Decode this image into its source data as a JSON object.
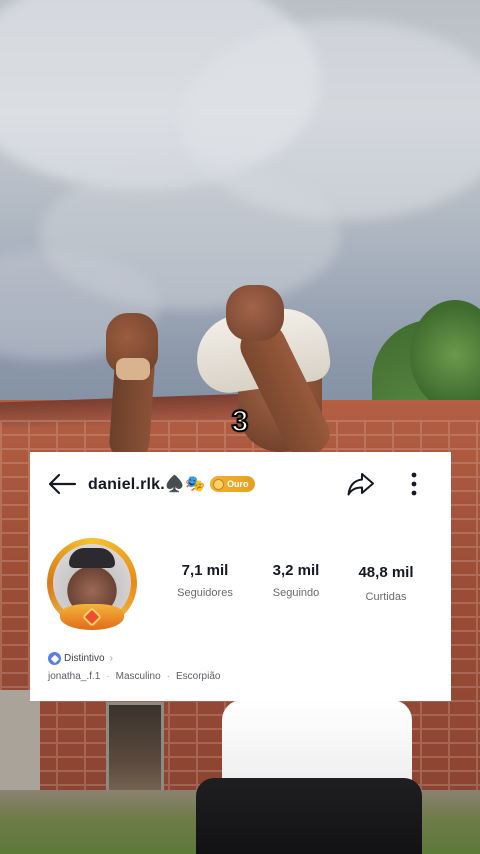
{
  "overlay": {
    "countdown": "3"
  },
  "profile": {
    "username": "daniel.rlk.♠️🎭",
    "tier_badge": "Ouro",
    "stats": [
      {
        "value": "7,1 mil",
        "label": "Seguidores"
      },
      {
        "value": "3,2 mil",
        "label": "Seguindo"
      },
      {
        "value": "48,8 mil",
        "label": "Curtidas"
      }
    ],
    "badge_link": "Distintivo",
    "info": {
      "handle": "jonatha_.f.1",
      "separator": "·",
      "gender": "Masculino",
      "zodiac": "Escorpião"
    }
  },
  "icons": {
    "back": "arrow-left-icon",
    "share": "share-arrow-icon",
    "more": "more-vertical-icon",
    "coin": "coin-icon",
    "shield": "shield-icon",
    "chevron": "chevron-right-icon"
  },
  "colors": {
    "card_bg": "#ffffff",
    "text_primary": "#161823",
    "text_secondary": "#6a6b72",
    "gold": "#f0b235",
    "badge_blue": "#5a7fe2"
  }
}
